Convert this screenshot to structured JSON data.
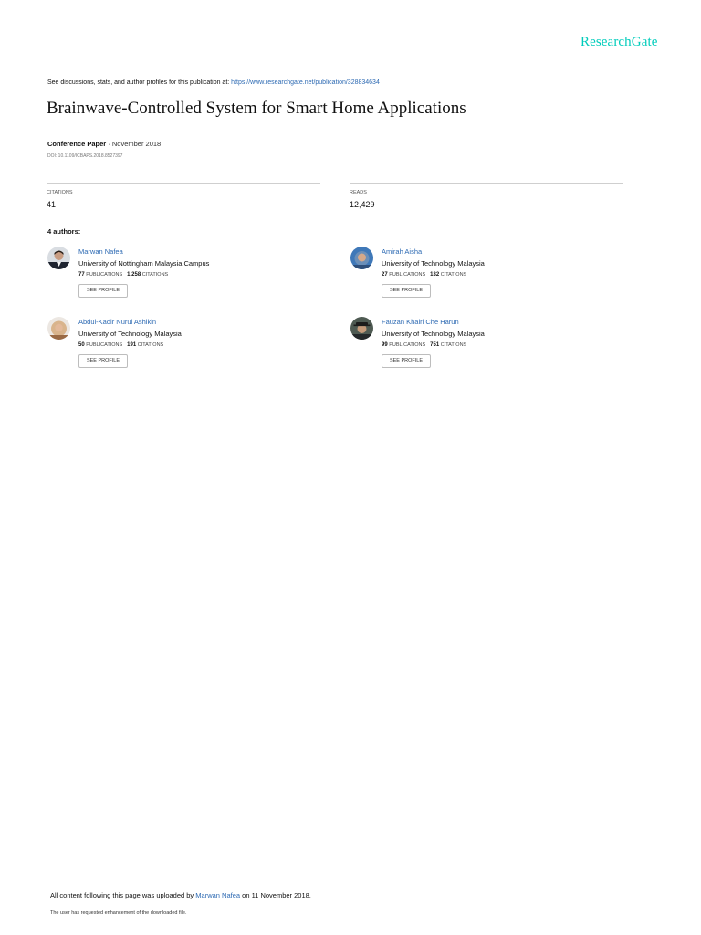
{
  "brand": "ResearchGate",
  "discussion": {
    "prefix": "See discussions, stats, and author profiles for this publication at: ",
    "url": "https://www.researchgate.net/publication/328834634"
  },
  "title": "Brainwave-Controlled System for Smart Home Applications",
  "meta": {
    "type": "Conference Paper",
    "date": " · November 2018",
    "doi": "DOI: 10.1109/ICBAPS.2018.8527397"
  },
  "stats": {
    "citations_label": "CITATIONS",
    "citations_value": "41",
    "reads_label": "READS",
    "reads_value": "12,429"
  },
  "authors_heading": "4 authors:",
  "authors": [
    {
      "name": "Marwan Nafea",
      "institution": "University of Nottingham Malaysia Campus",
      "publications": "77",
      "citations": "1,258",
      "avatar": "portrait-suit"
    },
    {
      "name": "Amirah Aisha",
      "institution": "University of Technology Malaysia",
      "publications": "27",
      "citations": "132",
      "avatar": "portrait-blue-headscarf"
    },
    {
      "name": "Abdul-Kadir Nurul Ashikin",
      "institution": "University of Technology Malaysia",
      "publications": "50",
      "citations": "191",
      "avatar": "portrait-beige-headscarf"
    },
    {
      "name": "Fauzan Khairi Che Harun",
      "institution": "University of Technology Malaysia",
      "publications": "99",
      "citations": "751",
      "avatar": "portrait-hat"
    }
  ],
  "labels": {
    "publications": "PUBLICATIONS",
    "citations": "CITATIONS",
    "see_profile": "SEE PROFILE"
  },
  "footer": {
    "upload_prefix": "All content following this page was uploaded by ",
    "uploader": "Marwan Nafea",
    "upload_suffix": " on 11 November 2018.",
    "enhancement": "The user has requested enhancement of the downloaded file."
  }
}
